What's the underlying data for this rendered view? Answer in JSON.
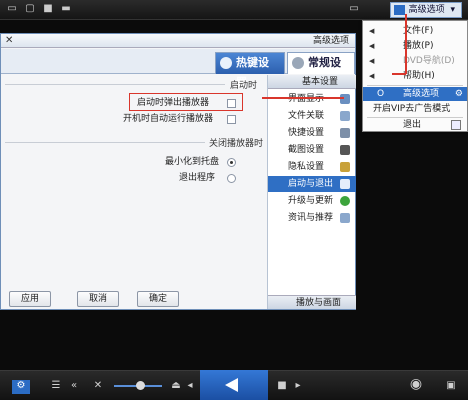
{
  "topbar": {
    "menu_label": "高级选项"
  },
  "context_menu": {
    "items": [
      {
        "label": "文件(F)",
        "state": "normal"
      },
      {
        "label": "播放(P)",
        "state": "normal"
      },
      {
        "label": "DVD导航(D)",
        "state": "disabled"
      },
      {
        "label": "帮助(H)",
        "state": "normal"
      },
      {
        "label": "高级选项",
        "shortcut": "O",
        "state": "highlighted"
      },
      {
        "label": "开启VIP去广告模式",
        "state": "normal"
      },
      {
        "label": "退出",
        "state": "normal"
      }
    ]
  },
  "dialog": {
    "title": "高级选项",
    "tabs": [
      {
        "label": "常规设置"
      },
      {
        "label": "热键设置"
      }
    ],
    "sidebar": {
      "header": "基本设置",
      "items": [
        {
          "label": "界面显示"
        },
        {
          "label": "文件关联"
        },
        {
          "label": "快捷设置"
        },
        {
          "label": "截图设置"
        },
        {
          "label": "隐私设置"
        },
        {
          "label": "启动与退出"
        },
        {
          "label": "升级与更新"
        },
        {
          "label": "资讯与推荐"
        }
      ],
      "footer": "播放与画面"
    },
    "content": {
      "startup_group": "启动时",
      "startup_options": [
        "启动时弹出播放器",
        "开机时自动运行播放器"
      ],
      "close_group": "关闭播放器时",
      "close_options": [
        "最小化到托盘",
        "退出程序"
      ]
    },
    "buttons": {
      "ok": "确定",
      "cancel": "取消",
      "apply": "应用"
    }
  },
  "colors": {
    "accent": "#2f6fc4",
    "highlight_box": "#d9362c"
  },
  "icons": {
    "bottom_left": "gear-icon",
    "bottom_right": "eye-icon"
  }
}
